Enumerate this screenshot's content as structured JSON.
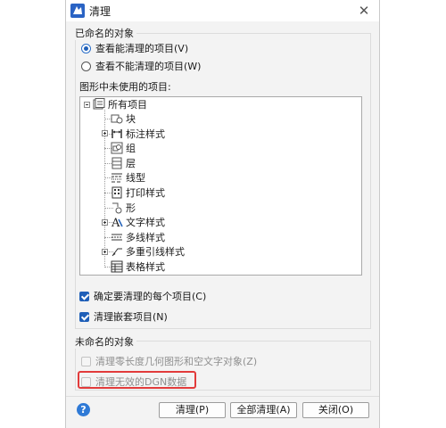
{
  "window": {
    "title": "清理",
    "close_symbol": "✕"
  },
  "named_group": {
    "title": "已命名的对象",
    "radio_purgeable": "查看能清理的项目(V)",
    "radio_unpurgeable": "查看不能清理的项目(W)",
    "selected": "purgeable"
  },
  "tree": {
    "label": "图形中未使用的项目:",
    "root": "所有项目",
    "items": [
      {
        "label": "块",
        "icon": "block-icon",
        "expandable": false
      },
      {
        "label": "标注样式",
        "icon": "dimension-style-icon",
        "expandable": true
      },
      {
        "label": "组",
        "icon": "group-icon",
        "expandable": false
      },
      {
        "label": "层",
        "icon": "layer-icon",
        "expandable": false
      },
      {
        "label": "线型",
        "icon": "linetype-icon",
        "expandable": false
      },
      {
        "label": "打印样式",
        "icon": "plot-style-icon",
        "expandable": false
      },
      {
        "label": "形",
        "icon": "shape-icon",
        "expandable": false
      },
      {
        "label": "文字样式",
        "icon": "text-style-icon",
        "expandable": true
      },
      {
        "label": "多线样式",
        "icon": "multiline-style-icon",
        "expandable": false
      },
      {
        "label": "多重引线样式",
        "icon": "multileader-style-icon",
        "expandable": true
      },
      {
        "label": "表格样式",
        "icon": "table-style-icon",
        "expandable": false
      }
    ]
  },
  "options": {
    "confirm_each": "确定要清理的每个项目(C)",
    "purge_nested": "清理嵌套项目(N)",
    "confirm_each_checked": true,
    "purge_nested_checked": true
  },
  "unnamed_group": {
    "title": "未命名的对象",
    "zero_length": "清理零长度几何图形和空文字对象(Z)",
    "invalid_dgn": "清理无效的DGN数据"
  },
  "buttons": {
    "help": "?",
    "purge": "清理(P)",
    "purge_all": "全部清理(A)",
    "close": "关闭(O)"
  },
  "colors": {
    "accent": "#1f5fb8",
    "highlight": "#e23b3b"
  }
}
